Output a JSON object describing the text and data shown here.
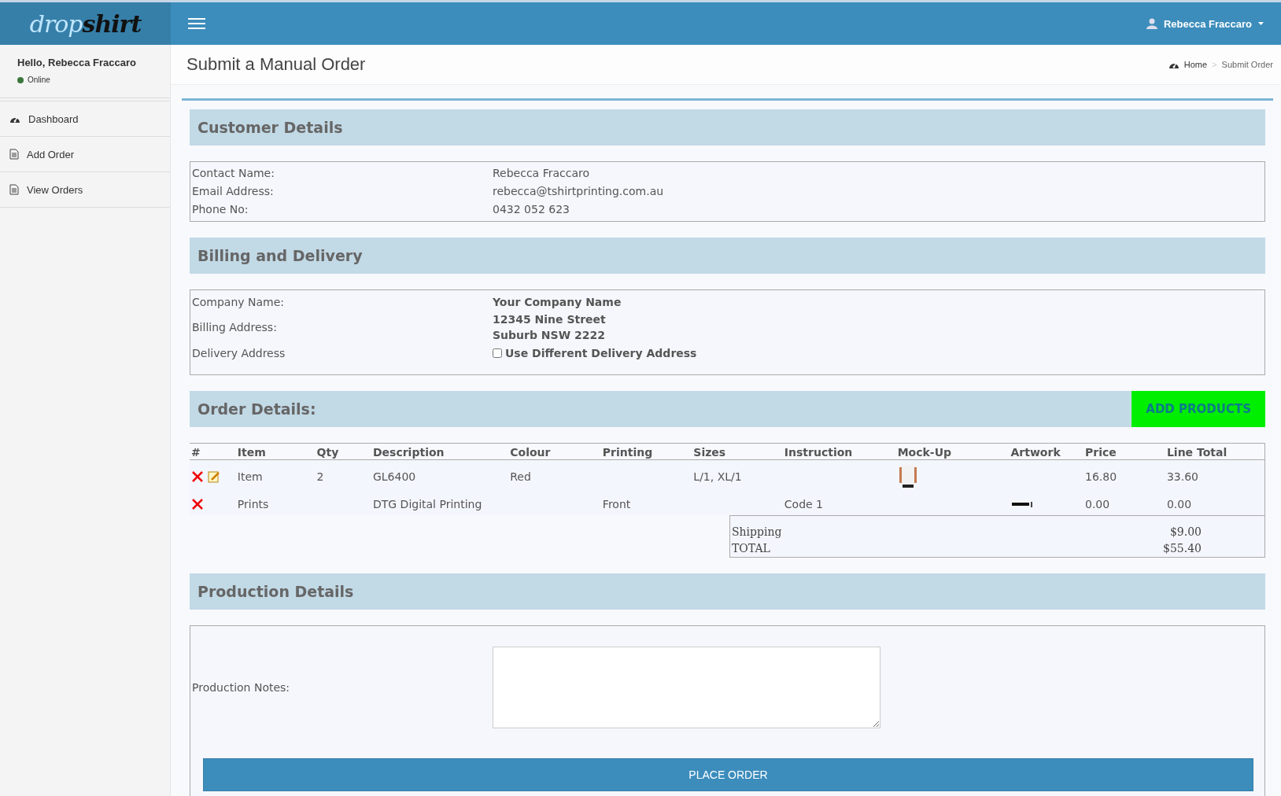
{
  "logo": {
    "part_1": "drop",
    "part_2": "shirt"
  },
  "topbar": {
    "user": "Rebecca Fraccaro"
  },
  "sidebar": {
    "greeting": "Hello, Rebecca Fraccaro",
    "status": {
      "label": "Online",
      "color": "#3c763d"
    },
    "items": [
      {
        "label": "Dashboard",
        "kind": "dashboard",
        "selected": false
      },
      {
        "label": "Add Order",
        "kind": "document",
        "selected": false
      },
      {
        "label": "View Orders",
        "kind": "document",
        "selected": false
      }
    ]
  },
  "page": {
    "title": "Submit a Manual Order",
    "breadcrumb": [
      "Home",
      "Submit Order"
    ],
    "breadcrumb_separator": ">"
  },
  "customer": {
    "title": "Customer Details",
    "rows": [
      {
        "label": "Contact Name:",
        "value": "Rebecca Fraccaro"
      },
      {
        "label": "Email Address:",
        "value": "rebecca@tshirtprinting.com.au"
      },
      {
        "label": "Phone No:",
        "value": "0432 052 623"
      }
    ]
  },
  "billing": {
    "title": "Billing and Delivery",
    "company_label": "Company Name:",
    "company": "Your Company Name",
    "address_label": "Billing Address:",
    "address_lines": [
      "12345 Nine Street",
      "Suburb NSW 2222"
    ],
    "delivery_label": "Delivery Address",
    "delivery_checkbox": {
      "label": "Use Different Delivery Address",
      "checked": false
    }
  },
  "order": {
    "title": "Order Details:",
    "add_button": "ADD PRODUCTS",
    "columns": [
      "#",
      "Item",
      "Qty",
      "Description",
      "Colour",
      "Printing",
      "Sizes",
      "Instruction",
      "Mock-Up",
      "Artwork",
      "Price",
      "Line Total"
    ],
    "rows": [
      {
        "editable": true,
        "item": "Item",
        "qty": "2",
        "description": "GL6400",
        "colour": "Red",
        "printing": "",
        "sizes": "L/1, XL/1",
        "instruction": "",
        "artwork": null,
        "price": "16.80",
        "line_total": "33.60"
      },
      {
        "editable": false,
        "item": "Prints",
        "qty": "",
        "description": "DTG Digital Printing",
        "colour": "",
        "printing": "Front",
        "sizes": "",
        "instruction": "Code 1",
        "mockup": null,
        "price": "0.00",
        "line_total": "0.00"
      }
    ],
    "totals": [
      {
        "label": "Shipping",
        "value": "$9.00"
      },
      {
        "label": "TOTAL",
        "value": "$55.40"
      }
    ]
  },
  "production": {
    "title": "Production Details",
    "notes_label": "Production Notes:",
    "submit": "PLACE ORDER"
  }
}
